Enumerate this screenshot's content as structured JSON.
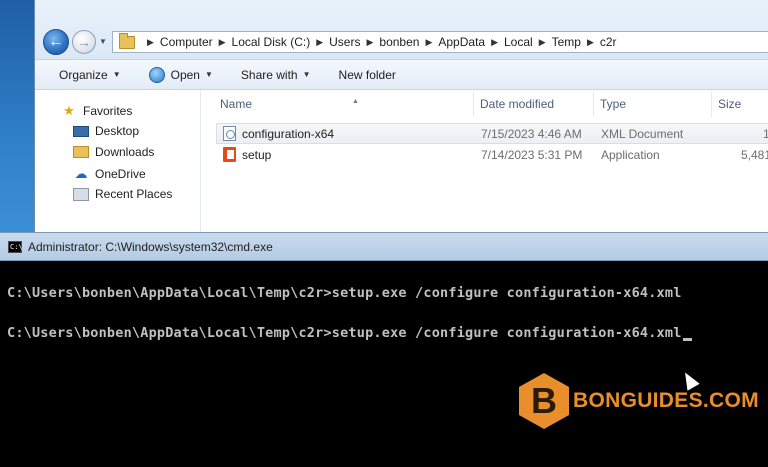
{
  "explorer": {
    "breadcrumbs": [
      "Computer",
      "Local Disk (C:)",
      "Users",
      "bonben",
      "AppData",
      "Local",
      "Temp",
      "c2r"
    ],
    "toolbar": {
      "organize": "Organize",
      "open": "Open",
      "share_with": "Share with",
      "new_folder": "New folder"
    },
    "nav": {
      "favorites": "Favorites",
      "items": [
        "Desktop",
        "Downloads",
        "OneDrive",
        "Recent Places"
      ]
    },
    "columns": {
      "name": "Name",
      "date_modified": "Date modified",
      "type": "Type",
      "size": "Size"
    },
    "files": [
      {
        "name": "configuration-x64",
        "date": "7/15/2023 4:46 AM",
        "type": "XML Document",
        "size": "1",
        "selected": true
      },
      {
        "name": "setup",
        "date": "7/14/2023 5:31 PM",
        "type": "Application",
        "size": "5,481",
        "selected": false
      }
    ]
  },
  "cmd": {
    "title": "Administrator: C:\\Windows\\system32\\cmd.exe",
    "icon_text": "C:\\",
    "lines": [
      "C:\\Users\\bonben\\AppData\\Local\\Temp\\c2r>setup.exe /configure configuration-x64.xml",
      "C:\\Users\\bonben\\AppData\\Local\\Temp\\c2r>setup.exe /configure configuration-x64.xml"
    ]
  },
  "watermark": {
    "logo_letter": "B",
    "text": "BONGUIDES.COM",
    "color": "#e88f2c"
  }
}
